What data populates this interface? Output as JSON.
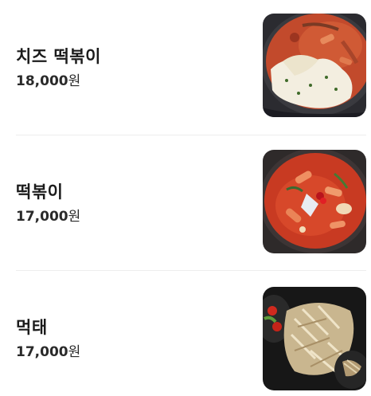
{
  "menu": {
    "items": [
      {
        "name": "치즈 떡볶이",
        "price": "18,000",
        "currency": "원",
        "image_icon": "cheese-tteokbokki-photo"
      },
      {
        "name": "떡볶이",
        "price": "17,000",
        "currency": "원",
        "image_icon": "tteokbokki-photo"
      },
      {
        "name": "먹태",
        "price": "17,000",
        "currency": "원",
        "image_icon": "dried-pollack-photo"
      }
    ]
  }
}
